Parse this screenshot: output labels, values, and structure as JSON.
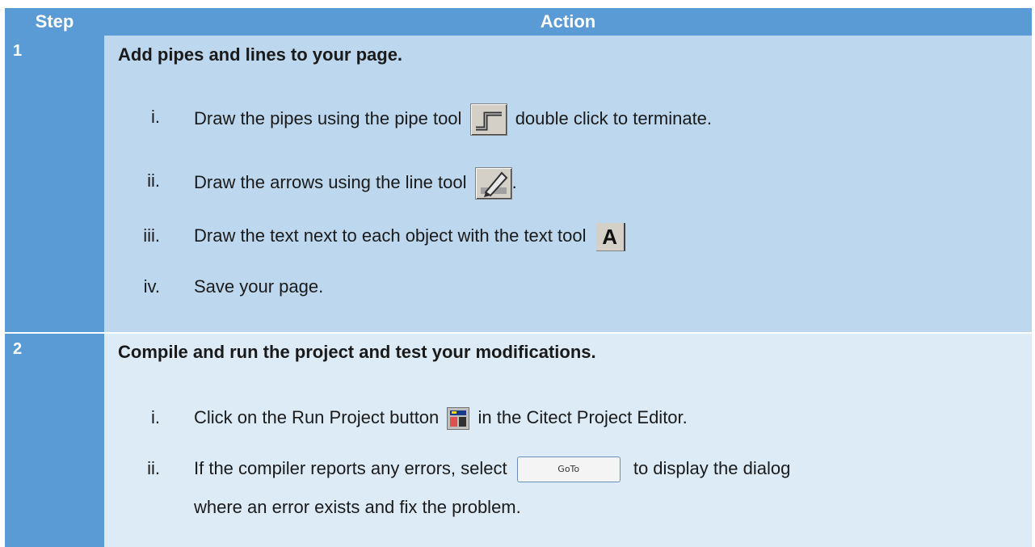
{
  "header": {
    "step": "Step",
    "action": "Action"
  },
  "rows": [
    {
      "step": "1",
      "title": "Add pipes and lines to your page.",
      "items": [
        {
          "num": "i.",
          "before": "Draw the pipes using the pipe tool",
          "icon": "pipe-tool-icon",
          "after": "double click to terminate."
        },
        {
          "num": "ii.",
          "before": "Draw the arrows using the line tool",
          "icon": "line-tool-icon",
          "after": "."
        },
        {
          "num": "iii.",
          "before": "Draw the text next to each object with the text tool",
          "icon": "text-tool-icon",
          "icon_label": "A",
          "after": ""
        },
        {
          "num": "iv.",
          "before": "Save your page.",
          "after": ""
        }
      ]
    },
    {
      "step": "2",
      "title": "Compile and run the project and test your modifications.",
      "items": [
        {
          "num": "i.",
          "before": "Click on the Run Project button",
          "icon": "run-project-icon",
          "after": "in the Citect Project Editor."
        },
        {
          "num": "ii.",
          "before": "If the compiler reports any errors, select",
          "button_label": "GoTo",
          "after": "to display the dialog",
          "continuation": "where an error exists and fix the problem."
        }
      ]
    }
  ],
  "colors": {
    "header": "#5b9bd5",
    "row1": "#bdd7ee",
    "row2": "#ddebf7"
  }
}
